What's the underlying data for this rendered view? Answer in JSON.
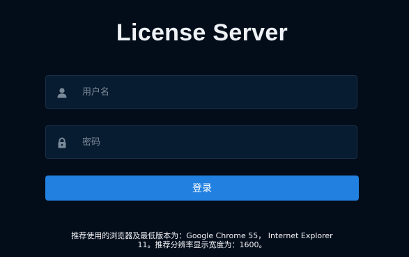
{
  "page": {
    "title": "License Server"
  },
  "form": {
    "username": {
      "placeholder": "用户名",
      "value": "",
      "icon": "user-icon"
    },
    "password": {
      "placeholder": "密码",
      "value": "",
      "icon": "lock-icon"
    },
    "login_label": "登录"
  },
  "footer": {
    "note_line1": "推荐使用的浏览器及最低版本为：Google Chrome 55， Internet Explorer",
    "note_line2": "11。推荐分辨率显示宽度为：1600。"
  },
  "colors": {
    "background": "#030d1a",
    "input_background": "#071c31",
    "input_border": "#1a2f44",
    "button": "#2280e0",
    "icon": "#7b8a99"
  }
}
